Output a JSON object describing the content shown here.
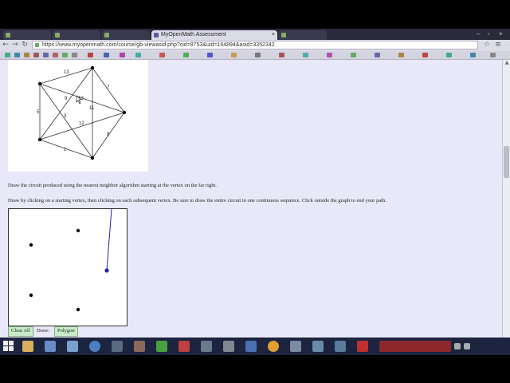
{
  "browser": {
    "tabs": [
      {
        "label": "",
        "active": false
      },
      {
        "label": "",
        "active": false
      },
      {
        "label": "",
        "active": false
      },
      {
        "label": "MyOpenMath Assessment",
        "active": true
      },
      {
        "label": "",
        "active": false
      }
    ],
    "close_tab_glyph": "×",
    "url": "https://www.myopenmath.com/course/gb-viewasid.php?cid=8753&uid=164894&asid=3352342",
    "nav_icons": [
      "back-icon",
      "forward-icon",
      "reload-icon"
    ]
  },
  "question": {
    "graph_edges": [
      {
        "label": "13"
      },
      {
        "label": "7"
      },
      {
        "label": "5"
      },
      {
        "label": "3"
      },
      {
        "label": "9"
      },
      {
        "label": "11"
      },
      {
        "label": "12"
      },
      {
        "label": "8"
      },
      {
        "label": "1"
      },
      {
        "label": "13"
      }
    ],
    "instruction_1": "Draw the circuit produced using the nearest neighbor algorithm starting at the vertex on the far right.",
    "instruction_2": "Draw by clicking on a starting vertex, then clicking on each subsequent vertex. Be sure to draw the entire circuit in one continuous sequence. Click outside the graph to end your path.",
    "clear_all_label": "Clear All",
    "draw_label": "Draw:",
    "polygon_label": "Polygon"
  },
  "colors": {
    "page_background": "#e8e8f8",
    "button_green": "#c7ecc7",
    "path_blue": "#2222aa"
  }
}
